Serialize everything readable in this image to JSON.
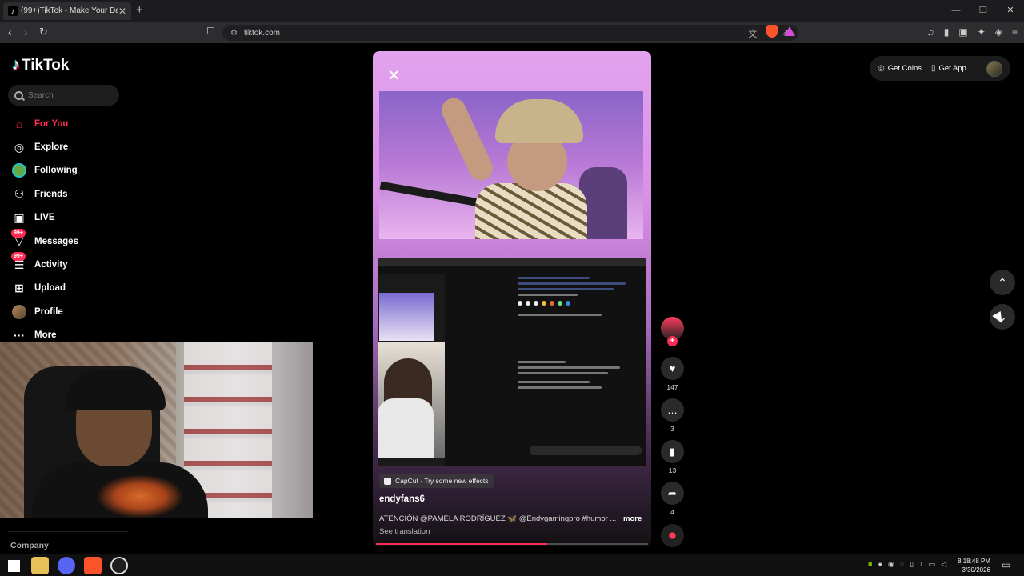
{
  "browser": {
    "tab_title": "(99+)TikTok - Make Your Day",
    "tab_close": "✕",
    "new_tab": "+",
    "window_controls": [
      "—",
      "❐",
      "✕"
    ],
    "url": "tiktok.com"
  },
  "sidebar": {
    "logo": "TikTok",
    "search_placeholder": "Search",
    "items": [
      {
        "label": "For You",
        "icon": "home-icon",
        "active": true
      },
      {
        "label": "Explore",
        "icon": "compass-icon"
      },
      {
        "label": "Following",
        "icon": "following-avatar-icon"
      },
      {
        "label": "Friends",
        "icon": "friends-icon"
      },
      {
        "label": "LIVE",
        "icon": "live-tv-icon"
      },
      {
        "label": "Messages",
        "icon": "messages-icon",
        "badge": "99+"
      },
      {
        "label": "Activity",
        "icon": "activity-icon",
        "badge": "99+"
      },
      {
        "label": "Upload",
        "icon": "upload-icon"
      },
      {
        "label": "Profile",
        "icon": "profile-avatar-icon"
      },
      {
        "label": "More",
        "icon": "more-dots-icon"
      }
    ],
    "company": "Company"
  },
  "video": {
    "capcut_tag": "CapCut · Try some new effects",
    "username": "endyfans6",
    "caption": "ATENCIÓN @PAMELA RODRÍGUEZ 🦋 @Endygamingpro #humor ...",
    "more": "more",
    "see_translation": "See translation",
    "progress": 0.63
  },
  "actions": {
    "likes": "147",
    "comments": "3",
    "saves": "13",
    "shares": "4"
  },
  "header": {
    "get_coins": "Get Coins",
    "get_app": "Get App"
  },
  "taskbar": {
    "time": "8:18:48 PM",
    "date": "3/30/2026"
  },
  "colors": {
    "accent": "#fe2c55",
    "background": "#000000"
  }
}
